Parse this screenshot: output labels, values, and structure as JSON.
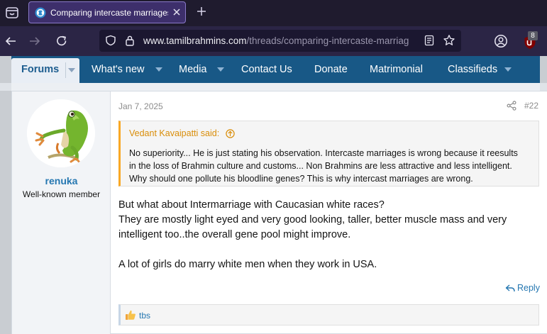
{
  "browser": {
    "tab": {
      "title": "Comparing intercaste marriages"
    },
    "url": {
      "host": "www.tamilbrahmins.com",
      "path": "/threads/comparing-intercaste-marriag"
    },
    "extension_badge_count": "8"
  },
  "site_nav": {
    "items": [
      {
        "label": "Forums",
        "active": true,
        "has_dropdown": true
      },
      {
        "label": "What's new",
        "has_dropdown": true
      },
      {
        "label": "Media",
        "has_dropdown": true
      },
      {
        "label": "Contact Us",
        "has_dropdown": false
      },
      {
        "label": "Donate",
        "has_dropdown": false
      },
      {
        "label": "Matrimonial",
        "has_dropdown": false
      },
      {
        "label": "Classifieds",
        "has_dropdown": true
      }
    ]
  },
  "post": {
    "author": {
      "name": "renuka",
      "title": "Well-known member"
    },
    "date": "Jan 7, 2025",
    "number": "#22",
    "quote": {
      "header": "Vedant Kavaipatti said:",
      "lines": [
        "No superiority... He is just stating his observation. Intercaste marriages is wrong because it reesults",
        "in the loss of Brahmin culture and customs... Non Brahmins are less attractive and less intelligent.",
        "Why should one pollute his bloodline genes? This is why intercast marriages are wrong."
      ]
    },
    "body_lines": [
      "But what about Intermarriage with Caucasian white races?",
      "They are mostly light eyed and very good looking, taller, better muscle mass and very",
      "intelligent too..the overall gene pool might improve.",
      "",
      "A lot of girls do marry white men when they work in USA."
    ],
    "reply_label": "Reply",
    "reactions": {
      "reactor": "tbs"
    }
  },
  "colors": {
    "nav_blue": "#185886",
    "link_blue": "#2577b1",
    "quote_accent": "#f9a825",
    "tab_active": "#3d2f6b"
  }
}
